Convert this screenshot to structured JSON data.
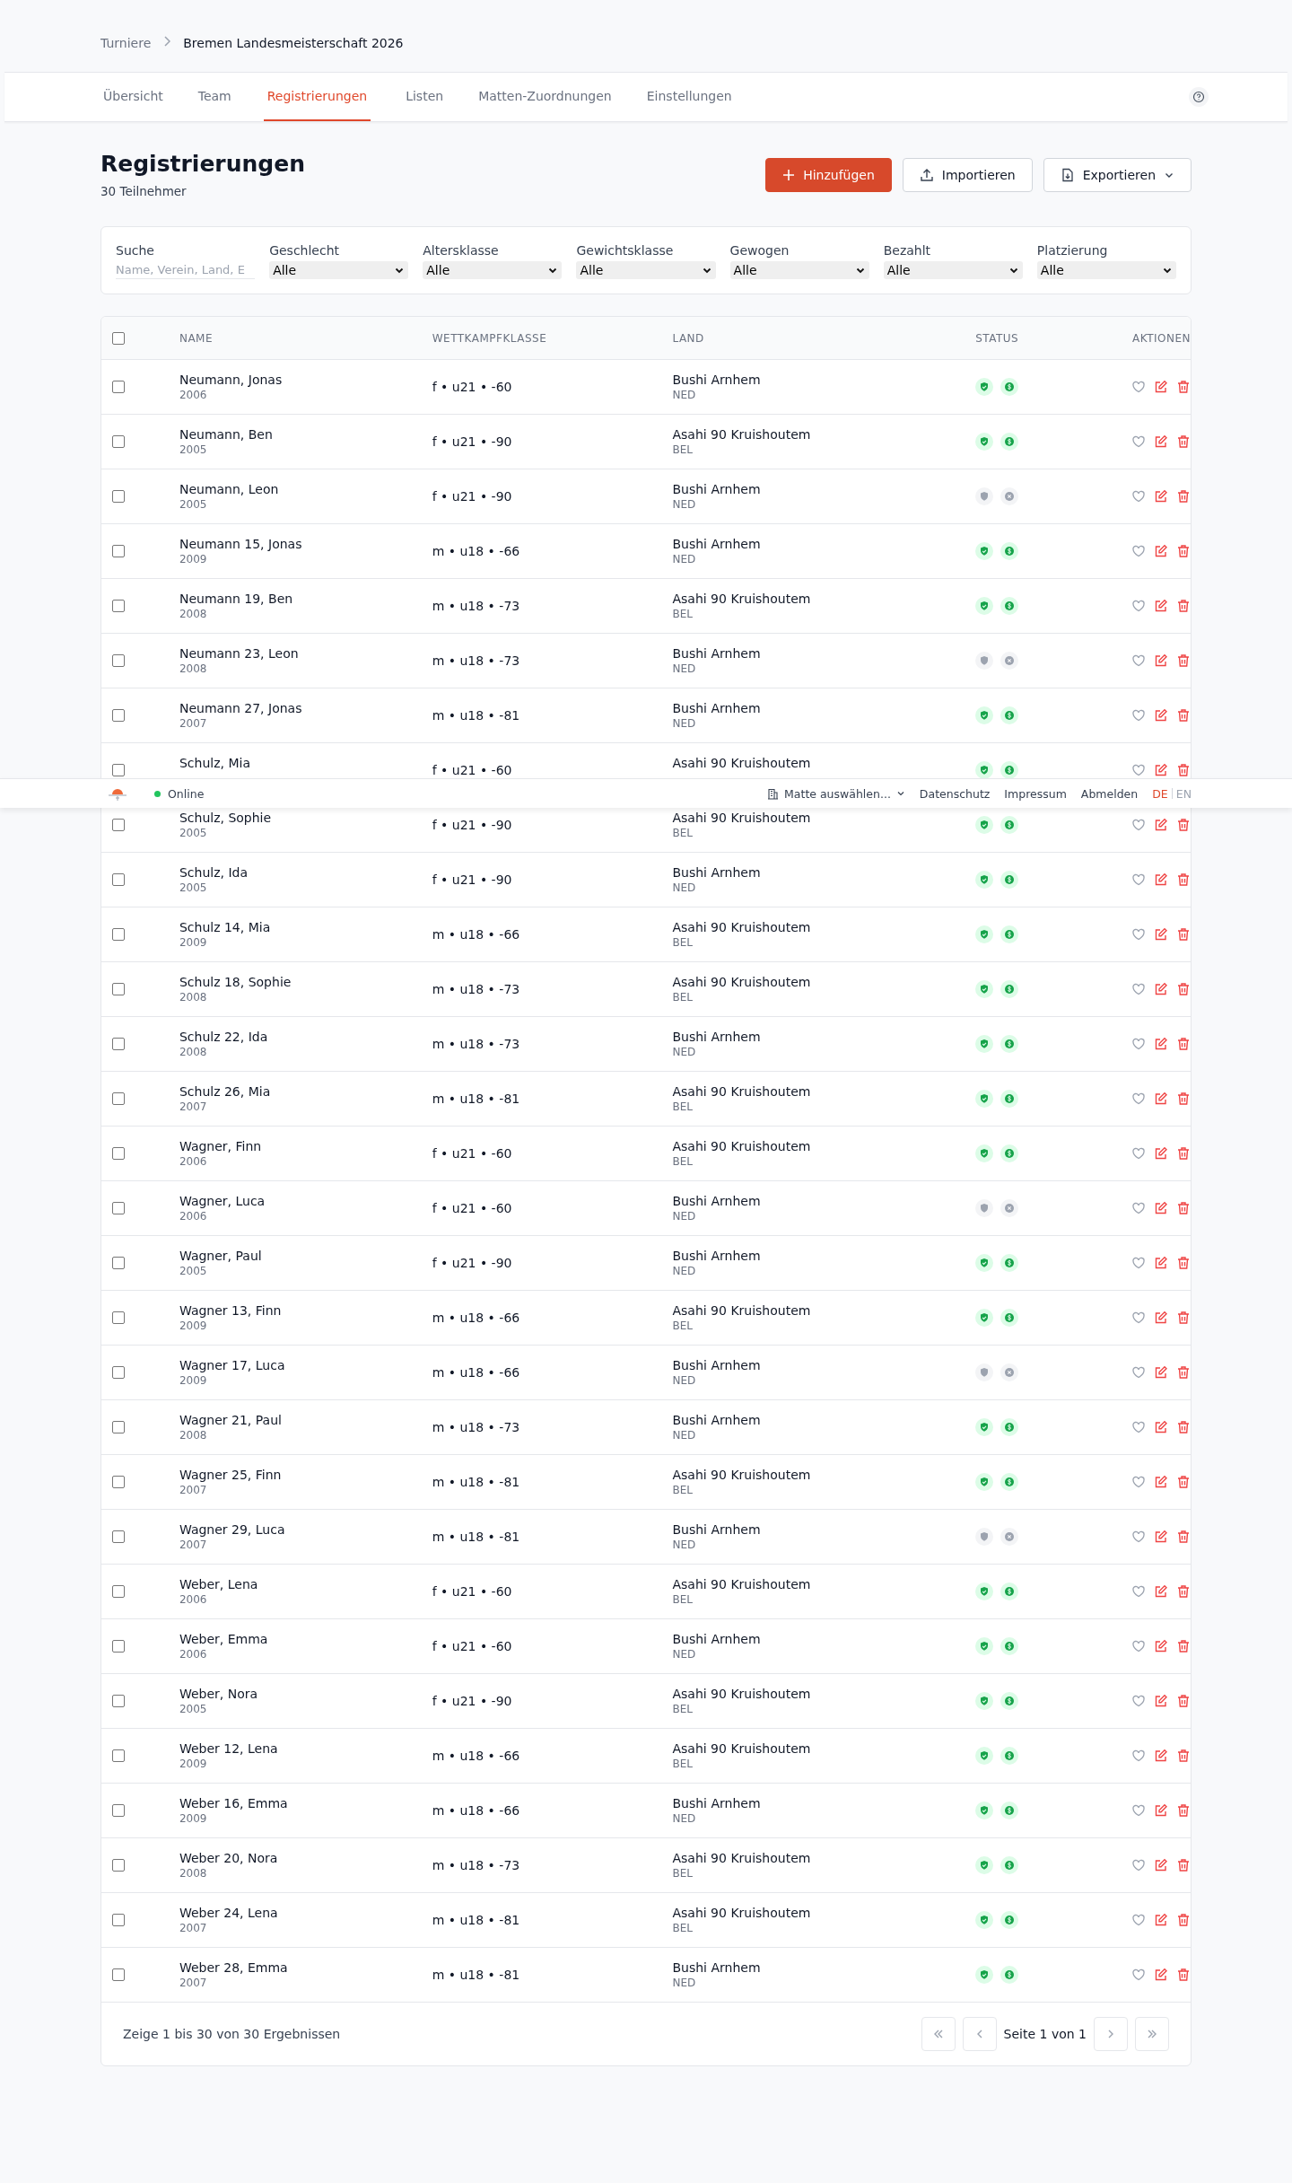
{
  "breadcrumb": [
    "Turniere",
    "Bremen Landesmeisterschaft 2026"
  ],
  "tabs": [
    {
      "label": "Übersicht",
      "selected": false
    },
    {
      "label": "Team",
      "selected": false
    },
    {
      "label": "Registrierungen",
      "selected": true
    },
    {
      "label": "Listen",
      "selected": false
    },
    {
      "label": "Matten-Zuordnungen",
      "selected": false
    },
    {
      "label": "Einstellungen",
      "selected": false
    }
  ],
  "title": "Registrierungen",
  "subtitle": "30 Teilnehmer",
  "actions": [
    {
      "label": "Hinzufügen",
      "kind": "add"
    },
    {
      "label": "Importieren",
      "kind": "import"
    },
    {
      "label": "Exportieren",
      "kind": "export"
    }
  ],
  "filters": [
    {
      "label": "Suche",
      "kind": "search",
      "placeholder": "Name, Verein, Land, E"
    },
    {
      "label": "Geschlecht",
      "kind": "select",
      "value": "Alle"
    },
    {
      "label": "Altersklasse",
      "kind": "select",
      "value": "Alle"
    },
    {
      "label": "Gewichtsklasse",
      "kind": "select",
      "value": "Alle"
    },
    {
      "label": "Gewogen",
      "kind": "select",
      "value": "Alle"
    },
    {
      "label": "Bezahlt",
      "kind": "select",
      "value": "Alle"
    },
    {
      "label": "Platzierung",
      "kind": "select",
      "value": "Alle"
    }
  ],
  "columns": [
    "NAME",
    "WETTKAMPFKLASSE",
    "LAND",
    "STATUS",
    "AKTIONEN"
  ],
  "select_all_checked": false,
  "rows": [
    {
      "checked": false,
      "name": "Neumann, Jonas",
      "year": "2006",
      "class": "f • u21 • -60",
      "club": "Bushi Arnhem",
      "country": "NED",
      "weighed": true,
      "paid": true
    },
    {
      "checked": false,
      "name": "Neumann, Ben",
      "year": "2005",
      "class": "f • u21 • -90",
      "club": "Asahi 90 Kruishoutem",
      "country": "BEL",
      "weighed": true,
      "paid": true
    },
    {
      "checked": false,
      "name": "Neumann, Leon",
      "year": "2005",
      "class": "f • u21 • -90",
      "club": "Bushi Arnhem",
      "country": "NED",
      "weighed": false,
      "paid": false
    },
    {
      "checked": false,
      "name": "Neumann 15, Jonas",
      "year": "2009",
      "class": "m • u18 • -66",
      "club": "Bushi Arnhem",
      "country": "NED",
      "weighed": true,
      "paid": true
    },
    {
      "checked": false,
      "name": "Neumann 19, Ben",
      "year": "2008",
      "class": "m • u18 • -73",
      "club": "Asahi 90 Kruishoutem",
      "country": "BEL",
      "weighed": true,
      "paid": true
    },
    {
      "checked": false,
      "name": "Neumann 23, Leon",
      "year": "2008",
      "class": "m • u18 • -73",
      "club": "Bushi Arnhem",
      "country": "NED",
      "weighed": false,
      "paid": false
    },
    {
      "checked": false,
      "name": "Neumann 27, Jonas",
      "year": "2007",
      "class": "m • u18 • -81",
      "club": "Bushi Arnhem",
      "country": "NED",
      "weighed": true,
      "paid": true
    },
    {
      "checked": false,
      "name": "Schulz, Mia",
      "class": "f • u21 • -60",
      "club": "Asahi 90 Kruishoutem",
      "weighed": true,
      "paid": true
    },
    {
      "checked": false,
      "name": "Schulz, Sophie",
      "year": "2005",
      "class": "f • u21 • -90",
      "club": "Asahi 90 Kruishoutem",
      "country": "BEL",
      "weighed": true,
      "paid": true
    },
    {
      "checked": false,
      "name": "Schulz, Ida",
      "year": "2005",
      "class": "f • u21 • -90",
      "club": "Bushi Arnhem",
      "country": "NED",
      "weighed": true,
      "paid": true
    },
    {
      "checked": false,
      "name": "Schulz 14, Mia",
      "year": "2009",
      "class": "m • u18 • -66",
      "club": "Asahi 90 Kruishoutem",
      "country": "BEL",
      "weighed": true,
      "paid": true
    },
    {
      "checked": false,
      "name": "Schulz 18, Sophie",
      "year": "2008",
      "class": "m • u18 • -73",
      "club": "Asahi 90 Kruishoutem",
      "country": "BEL",
      "weighed": true,
      "paid": true
    },
    {
      "checked": false,
      "name": "Schulz 22, Ida",
      "year": "2008",
      "class": "m • u18 • -73",
      "club": "Bushi Arnhem",
      "country": "NED",
      "weighed": true,
      "paid": true
    },
    {
      "checked": false,
      "name": "Schulz 26, Mia",
      "year": "2007",
      "class": "m • u18 • -81",
      "club": "Asahi 90 Kruishoutem",
      "country": "BEL",
      "weighed": true,
      "paid": true
    },
    {
      "checked": false,
      "name": "Wagner, Finn",
      "year": "2006",
      "class": "f • u21 • -60",
      "club": "Asahi 90 Kruishoutem",
      "country": "BEL",
      "weighed": true,
      "paid": true
    },
    {
      "checked": false,
      "name": "Wagner, Luca",
      "year": "2006",
      "class": "f • u21 • -60",
      "club": "Bushi Arnhem",
      "country": "NED",
      "weighed": false,
      "paid": false
    },
    {
      "checked": false,
      "name": "Wagner, Paul",
      "year": "2005",
      "class": "f • u21 • -90",
      "club": "Bushi Arnhem",
      "country": "NED",
      "weighed": true,
      "paid": true
    },
    {
      "checked": false,
      "name": "Wagner 13, Finn",
      "year": "2009",
      "class": "m • u18 • -66",
      "club": "Asahi 90 Kruishoutem",
      "country": "BEL",
      "weighed": true,
      "paid": true
    },
    {
      "checked": false,
      "name": "Wagner 17, Luca",
      "year": "2009",
      "class": "m • u18 • -66",
      "club": "Bushi Arnhem",
      "country": "NED",
      "weighed": false,
      "paid": false
    },
    {
      "checked": false,
      "name": "Wagner 21, Paul",
      "year": "2008",
      "class": "m • u18 • -73",
      "club": "Bushi Arnhem",
      "country": "NED",
      "weighed": true,
      "paid": true
    },
    {
      "checked": false,
      "name": "Wagner 25, Finn",
      "year": "2007",
      "class": "m • u18 • -81",
      "club": "Asahi 90 Kruishoutem",
      "country": "BEL",
      "weighed": true,
      "paid": true
    },
    {
      "checked": false,
      "name": "Wagner 29, Luca",
      "year": "2007",
      "class": "m • u18 • -81",
      "club": "Bushi Arnhem",
      "country": "NED",
      "weighed": false,
      "paid": false
    },
    {
      "checked": false,
      "name": "Weber, Lena",
      "year": "2006",
      "class": "f • u21 • -60",
      "club": "Asahi 90 Kruishoutem",
      "country": "BEL",
      "weighed": true,
      "paid": true
    },
    {
      "checked": false,
      "name": "Weber, Emma",
      "year": "2006",
      "class": "f • u21 • -60",
      "club": "Bushi Arnhem",
      "country": "NED",
      "weighed": true,
      "paid": true
    },
    {
      "checked": false,
      "name": "Weber, Nora",
      "year": "2005",
      "class": "f • u21 • -90",
      "club": "Asahi 90 Kruishoutem",
      "country": "BEL",
      "weighed": true,
      "paid": true
    },
    {
      "checked": false,
      "name": "Weber 12, Lena",
      "year": "2009",
      "class": "m • u18 • -66",
      "club": "Asahi 90 Kruishoutem",
      "country": "BEL",
      "weighed": true,
      "paid": true
    },
    {
      "checked": false,
      "name": "Weber 16, Emma",
      "year": "2009",
      "class": "m • u18 • -66",
      "club": "Bushi Arnhem",
      "country": "NED",
      "weighed": true,
      "paid": true
    },
    {
      "checked": false,
      "name": "Weber 20, Nora",
      "year": "2008",
      "class": "m • u18 • -73",
      "club": "Asahi 90 Kruishoutem",
      "country": "BEL",
      "weighed": true,
      "paid": true
    },
    {
      "checked": false,
      "name": "Weber 24, Lena",
      "year": "2007",
      "class": "m • u18 • -81",
      "club": "Asahi 90 Kruishoutem",
      "country": "BEL",
      "weighed": true,
      "paid": true
    },
    {
      "checked": false,
      "name": "Weber 28, Emma",
      "year": "2007",
      "class": "m • u18 • -81",
      "club": "Bushi Arnhem",
      "country": "NED",
      "weighed": true,
      "paid": true
    }
  ],
  "pagination": {
    "summary": "Zeige 1 bis 30 von 30 Ergebnissen",
    "page": "Seite 1 von 1"
  },
  "footer": {
    "status": "Online",
    "online": true,
    "mat_select": "Matte auswählen...",
    "links": [
      "Datenschutz",
      "Impressum",
      "Abmelden"
    ],
    "languages": [
      {
        "label": "DE",
        "selected": true
      },
      {
        "label": "EN",
        "selected": false
      }
    ]
  }
}
